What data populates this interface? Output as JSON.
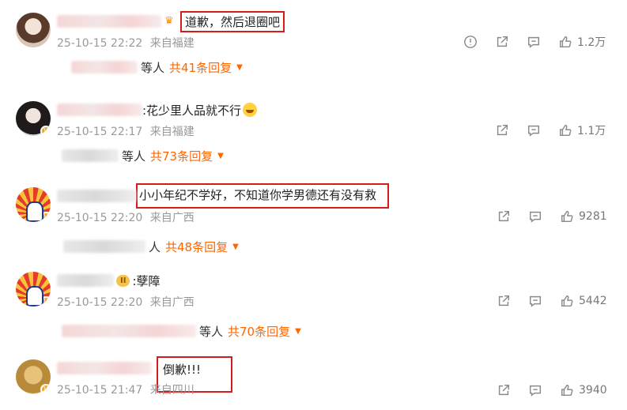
{
  "comments": [
    {
      "text": "道歉，然后退圈吧",
      "meta": {
        "time": "25-10-15 22:22",
        "location": "来自福建"
      },
      "likes": "1.2万",
      "replies": {
        "who": "等人",
        "total": "共41条回复"
      }
    },
    {
      "text": ":花少里人品就不行",
      "meta": {
        "time": "25-10-15 22:17",
        "location": "来自福建"
      },
      "likes": "1.1万",
      "replies": {
        "who": "等人",
        "total": "共73条回复"
      }
    },
    {
      "text": "小小年纪不学好，不知道你学男德还有没有救",
      "meta": {
        "time": "25-10-15 22:20",
        "location": "来自广西"
      },
      "likes": "9281",
      "replies": {
        "who": "人",
        "total": "共48条回复"
      }
    },
    {
      "text": ":孽障",
      "badge": "II",
      "meta": {
        "time": "25-10-15 22:20",
        "location": "来自广西"
      },
      "likes": "5442",
      "replies": {
        "who": "等人",
        "total": "共70条回复"
      }
    },
    {
      "text": "倒歉!!!",
      "meta": {
        "time": "25-10-15 21:47",
        "location": "来自四川"
      },
      "likes": "3940"
    }
  ],
  "icons": {
    "report": "exclamation-circle-icon",
    "share": "share-icon",
    "comment": "comment-icon",
    "like": "thumb-up-icon",
    "medal": "crown-icon",
    "caret": "caret-down-icon"
  },
  "colors": {
    "accent": "#ff6600",
    "highlight_box": "#d41c1c",
    "meta": "#999999"
  }
}
